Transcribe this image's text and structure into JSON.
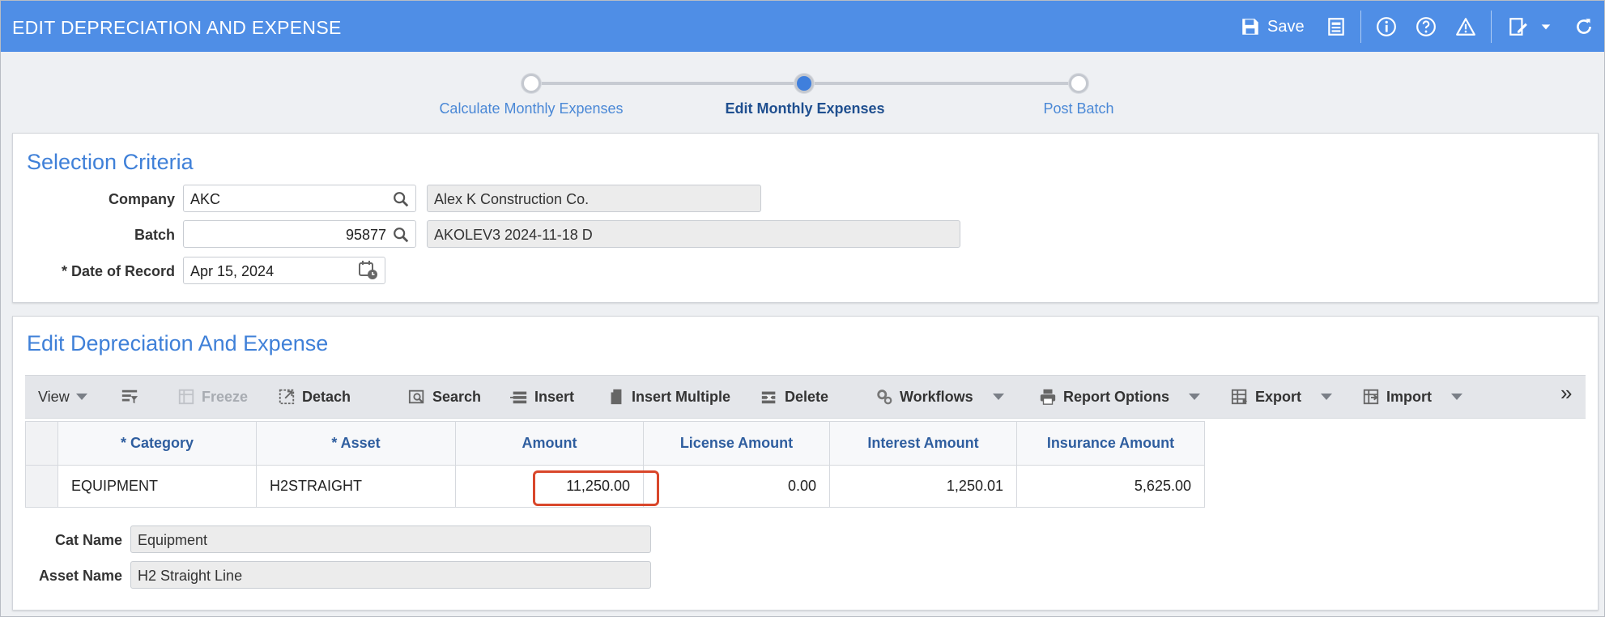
{
  "header": {
    "title": "EDIT DEPRECIATION AND EXPENSE",
    "save_label": "Save",
    "icons": [
      "save-icon",
      "print-icon",
      "info-icon",
      "help-icon",
      "warning-icon",
      "edit-notes-icon",
      "chevron-down-icon",
      "refresh-icon"
    ],
    "color": "#4f8ee6"
  },
  "stepper": {
    "steps": [
      {
        "label": "Calculate Monthly Expenses",
        "state": "done"
      },
      {
        "label": "Edit Monthly Expenses",
        "state": "active"
      },
      {
        "label": "Post Batch",
        "state": "pending"
      }
    ]
  },
  "selection": {
    "title": "Selection Criteria",
    "company_label": "Company",
    "company_value": "AKC",
    "company_name": "Alex K Construction Co.",
    "batch_label": "Batch",
    "batch_value": "95877",
    "batch_desc": "AKOLEV3 2024-11-18 D",
    "date_label": "* Date of Record",
    "date_value": "Apr 15, 2024"
  },
  "edit": {
    "title": "Edit Depreciation And Expense",
    "toolbar": {
      "view": "View",
      "freeze": "Freeze",
      "detach": "Detach",
      "search": "Search",
      "insert": "Insert",
      "insert_multiple": "Insert Multiple",
      "delete": "Delete",
      "workflows": "Workflows",
      "report_options": "Report Options",
      "export": "Export",
      "import": "Import",
      "more": "»"
    },
    "grid": {
      "columns": [
        "* Category",
        "* Asset",
        "Amount",
        "License Amount",
        "Interest Amount",
        "Insurance Amount"
      ],
      "rows": [
        {
          "category": "EQUIPMENT",
          "asset": "H2STRAIGHT",
          "amount": "11,250.00",
          "license": "0.00",
          "interest": "1,250.01",
          "insurance": "5,625.00"
        }
      ]
    },
    "cat_name_label": "Cat Name",
    "cat_name_value": "Equipment",
    "asset_name_label": "Asset Name",
    "asset_name_value": "H2 Straight Line",
    "highlight_color": "#d9472b"
  }
}
